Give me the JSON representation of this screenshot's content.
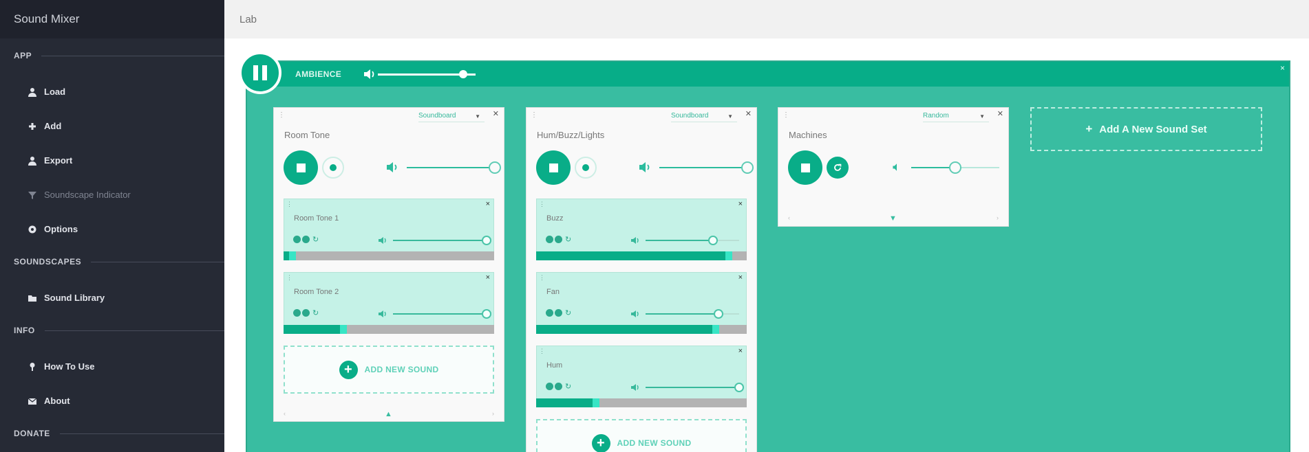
{
  "app": {
    "title": "Sound Mixer"
  },
  "topbar": {
    "title": "Lab"
  },
  "sidebar": {
    "sections": [
      {
        "label": "APP",
        "items": [
          {
            "label": "Load",
            "icon": "user-icon"
          },
          {
            "label": "Add",
            "icon": "plus-icon"
          },
          {
            "label": "Export",
            "icon": "user-icon"
          },
          {
            "label": "Soundscape Indicator",
            "icon": "filter-icon",
            "disabled": true
          },
          {
            "label": "Options",
            "icon": "gear-icon"
          }
        ]
      },
      {
        "label": "SOUNDSCAPES",
        "items": [
          {
            "label": "Sound Library",
            "icon": "folder-icon"
          }
        ]
      },
      {
        "label": "INFO",
        "items": [
          {
            "label": "How To Use",
            "icon": "pin-icon"
          },
          {
            "label": "About",
            "icon": "mail-icon"
          }
        ]
      },
      {
        "label": "DONATE",
        "items": []
      }
    ]
  },
  "ambience": {
    "title": "AMBIENCE",
    "volume": 0.87,
    "close": "×"
  },
  "cards": [
    {
      "title": "Room Tone",
      "type_label": "Soundboard",
      "volume": 1.0,
      "sounds": [
        {
          "name": "Room Tone 1",
          "volume": 1.0,
          "progress": 0.06
        },
        {
          "name": "Room Tone 2",
          "volume": 1.0,
          "progress": 0.3
        }
      ],
      "add_label": "ADD NEW SOUND"
    },
    {
      "title": "Hum/Buzz/Lights",
      "type_label": "Soundboard",
      "volume": 1.0,
      "sounds": [
        {
          "name": "Buzz",
          "volume": 0.72,
          "progress": 0.93
        },
        {
          "name": "Fan",
          "volume": 0.78,
          "progress": 0.87
        },
        {
          "name": "Hum",
          "volume": 1.0,
          "progress": 0.3
        }
      ],
      "add_label": "ADD NEW SOUND"
    },
    {
      "title": "Machines",
      "type_label": "Random",
      "volume": 0.5,
      "sounds": [],
      "add_label": ""
    }
  ],
  "add_set": {
    "label": "Add A New Sound Set"
  },
  "colors": {
    "primary": "#09ad88",
    "panel": "#39bda1",
    "sidebar": "#262a35"
  }
}
